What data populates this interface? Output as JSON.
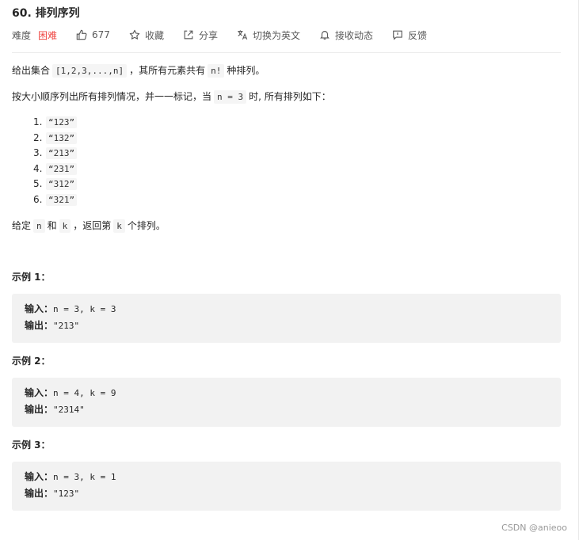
{
  "problem": {
    "title": "60. 排列序列",
    "difficulty_label": "难度",
    "difficulty_value": "困难",
    "likes": "677",
    "favorite_label": "收藏",
    "share_label": "分享",
    "translate_label": "切换为英文",
    "subscribe_label": "接收动态",
    "feedback_label": "反馈"
  },
  "description": {
    "p1_a": "给出集合",
    "p1_code": "[1,2,3,...,n]",
    "p1_b": "，其所有元素共有",
    "p1_code2": "n!",
    "p1_c": "种排列。",
    "p2_a": "按大小顺序列出所有排列情况，并一一标记，当",
    "p2_code": "n = 3",
    "p2_b": "时, 所有排列如下：",
    "list": [
      {
        "num": "1.",
        "value": "“123”"
      },
      {
        "num": "2.",
        "value": "“132”"
      },
      {
        "num": "3.",
        "value": "“213”"
      },
      {
        "num": "4.",
        "value": "“231”"
      },
      {
        "num": "5.",
        "value": "“312”"
      },
      {
        "num": "6.",
        "value": "“321”"
      }
    ],
    "p3_a": "给定",
    "p3_code_n": "n",
    "p3_b": "和",
    "p3_code_k": "k",
    "p3_c": "，返回第",
    "p3_code_k2": "k",
    "p3_d": "个排列。"
  },
  "examples": [
    {
      "title": "示例 1：",
      "input_label": "输入：",
      "input": "n = 3, k = 3",
      "output_label": "输出：",
      "output": "\"213\""
    },
    {
      "title": "示例 2：",
      "input_label": "输入：",
      "input": "n = 4, k = 9",
      "output_label": "输出：",
      "output": "\"2314\""
    },
    {
      "title": "示例 3：",
      "input_label": "输入：",
      "input": "n = 3, k = 1",
      "output_label": "输出：",
      "output": "\"123\""
    }
  ],
  "watermark": "CSDN @anieoo",
  "icons": {
    "like": "thumbs-up-icon",
    "favorite": "star-icon",
    "share": "share-icon",
    "translate": "translate-icon",
    "subscribe": "bell-icon",
    "feedback": "feedback-icon"
  },
  "colors": {
    "difficulty_hard": "#ef4743",
    "text": "#262626",
    "muted": "#595959",
    "code_bg": "#f5f5f5",
    "example_bg": "#f2f2f2"
  }
}
